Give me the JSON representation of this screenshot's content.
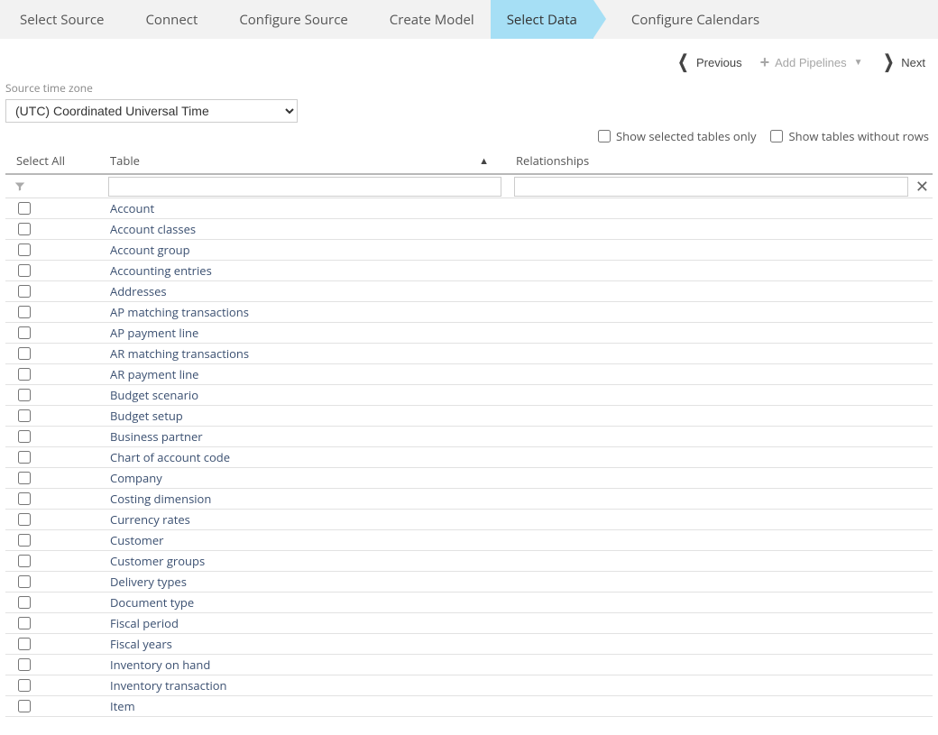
{
  "wizard": {
    "steps": [
      {
        "label": "Select Source"
      },
      {
        "label": "Connect"
      },
      {
        "label": "Configure Source"
      },
      {
        "label": "Create Model"
      },
      {
        "label": "Select Data",
        "active": true
      },
      {
        "label": "Configure Calendars"
      }
    ]
  },
  "nav": {
    "previous": "Previous",
    "addPipelines": "Add Pipelines",
    "next": "Next"
  },
  "timezone": {
    "label": "Source time zone",
    "value": "(UTC) Coordinated Universal Time"
  },
  "options": {
    "showSelected": "Show selected tables only",
    "showWithoutRows": "Show tables without rows"
  },
  "grid": {
    "header": {
      "selectAll": "Select All",
      "table": "Table",
      "relationships": "Relationships"
    },
    "rows": [
      {
        "name": "Account"
      },
      {
        "name": "Account classes"
      },
      {
        "name": "Account group"
      },
      {
        "name": "Accounting entries"
      },
      {
        "name": "Addresses"
      },
      {
        "name": "AP matching transactions"
      },
      {
        "name": "AP payment line"
      },
      {
        "name": "AR matching transactions"
      },
      {
        "name": "AR payment line"
      },
      {
        "name": "Budget scenario"
      },
      {
        "name": "Budget setup"
      },
      {
        "name": "Business partner"
      },
      {
        "name": "Chart of account code"
      },
      {
        "name": "Company"
      },
      {
        "name": "Costing dimension"
      },
      {
        "name": "Currency rates"
      },
      {
        "name": "Customer"
      },
      {
        "name": "Customer groups"
      },
      {
        "name": "Delivery types"
      },
      {
        "name": "Document type"
      },
      {
        "name": "Fiscal period"
      },
      {
        "name": "Fiscal years"
      },
      {
        "name": "Inventory on hand"
      },
      {
        "name": "Inventory transaction"
      },
      {
        "name": "Item"
      }
    ]
  }
}
